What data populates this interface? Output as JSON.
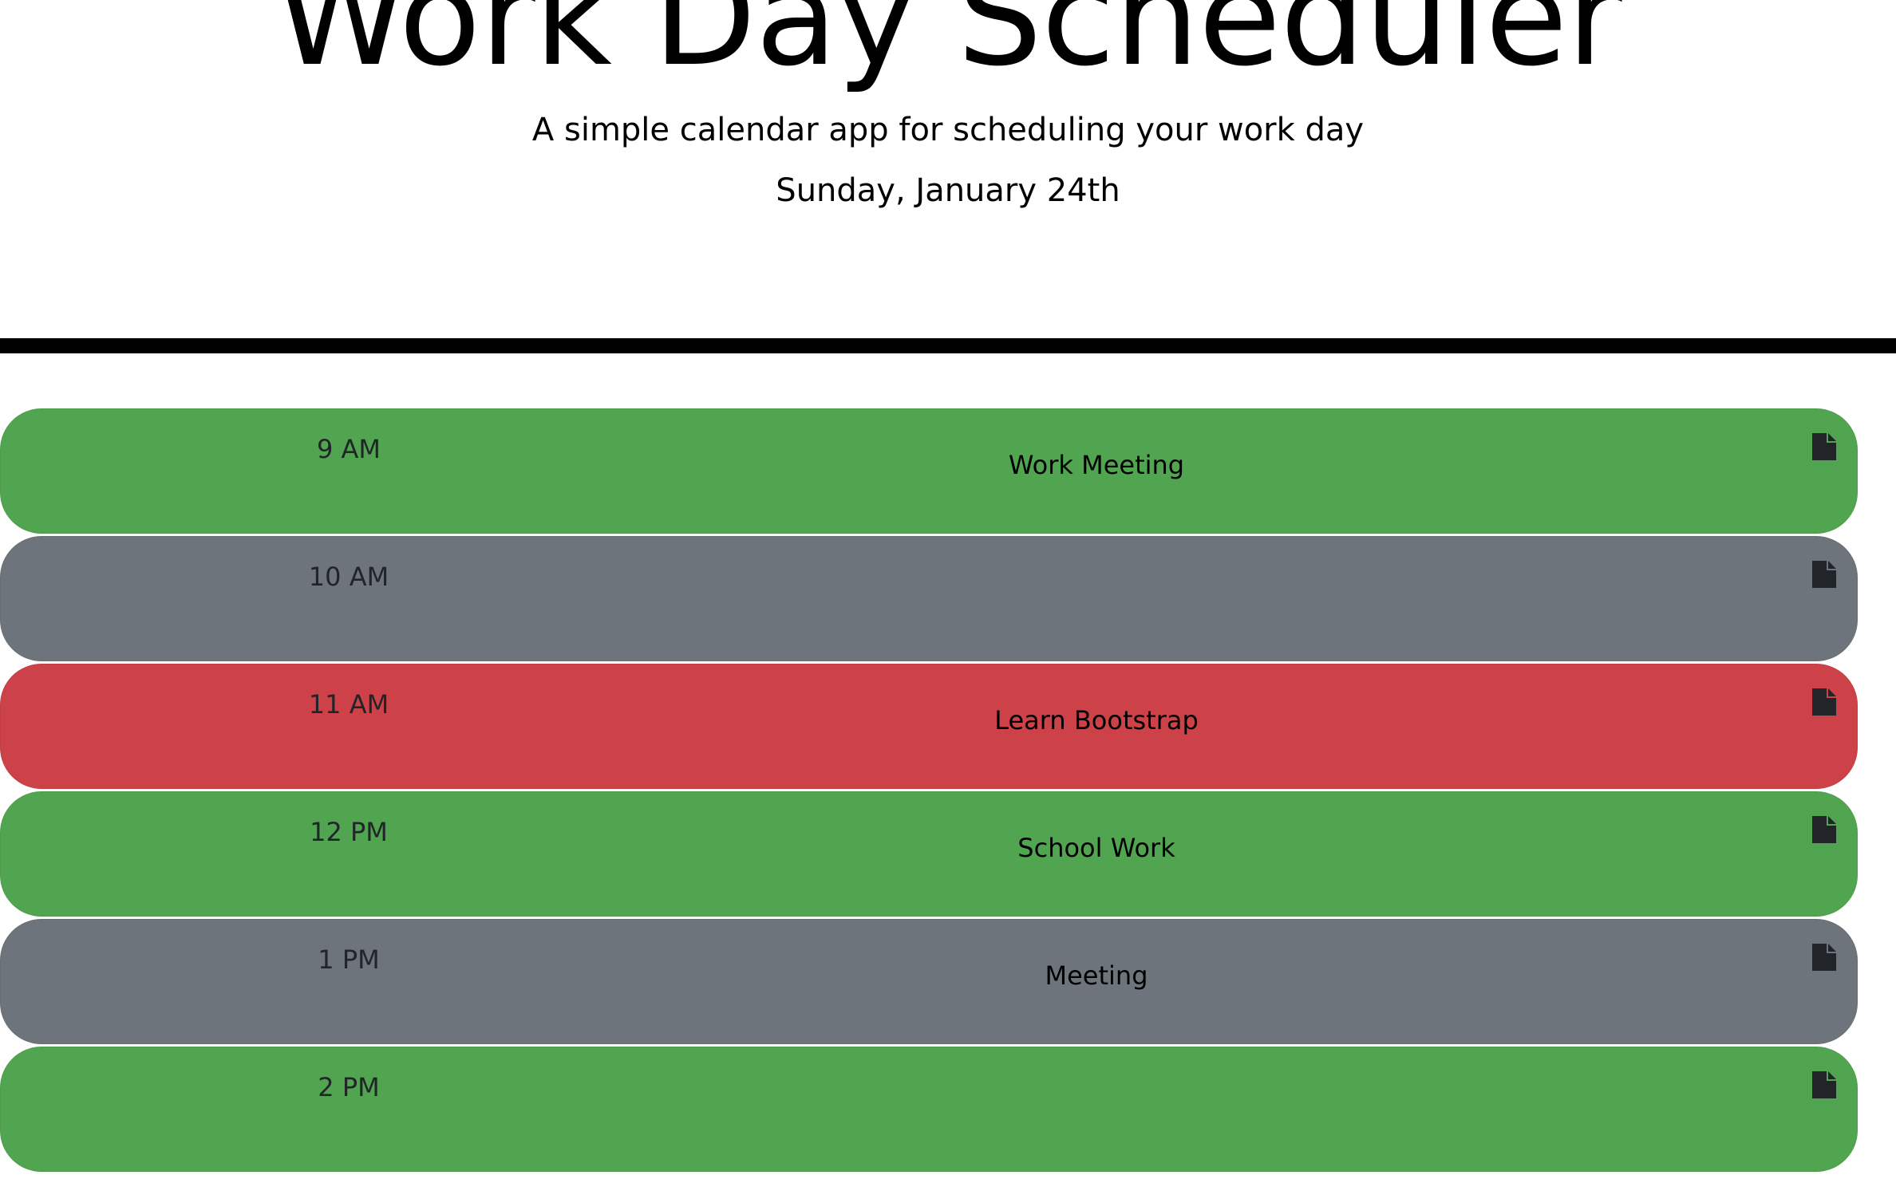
{
  "header": {
    "title": "Work Day Scheduler",
    "subtitle": "A simple calendar app for scheduling your work day",
    "date": "Sunday, January 24th"
  },
  "colors": {
    "present": "#cd4249",
    "past": "#6e747c",
    "future": "#52a550"
  },
  "rows": [
    {
      "hour": "9 AM",
      "task": "Work Meeting",
      "status": "future",
      "save_icon": "file-icon"
    },
    {
      "hour": "10 AM",
      "task": "",
      "status": "past",
      "save_icon": "file-icon"
    },
    {
      "hour": "11 AM",
      "task": "Learn Bootstrap",
      "status": "present",
      "save_icon": "file-icon"
    },
    {
      "hour": "12 PM",
      "task": "School Work",
      "status": "future",
      "save_icon": "file-icon"
    },
    {
      "hour": "1 PM",
      "task": "Meeting",
      "status": "past",
      "save_icon": "file-icon"
    },
    {
      "hour": "2 PM",
      "task": "",
      "status": "future",
      "save_icon": "file-icon"
    }
  ]
}
